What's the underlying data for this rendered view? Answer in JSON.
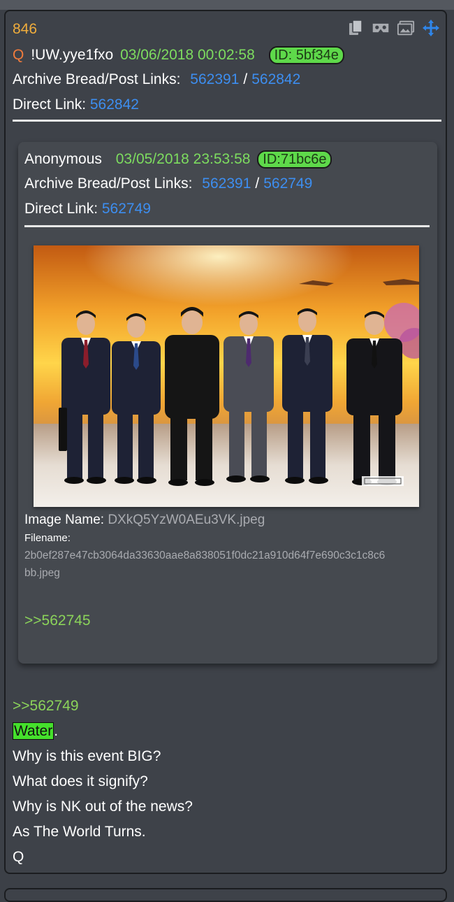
{
  "post": {
    "number": "846",
    "q_marker": "Q",
    "tripcode": "!UW.yye1fxo",
    "date": "03/06/2018 00:02:58",
    "id": "ID: 5bf34e",
    "archive_label": "Archive Bread/Post Links:",
    "archive_link1": "562391",
    "archive_sep": "/",
    "archive_link2": "562842",
    "direct_label": "Direct Link:",
    "direct_link": "562842"
  },
  "quoted": {
    "name": "Anonymous",
    "date": "03/05/2018 23:53:58",
    "id": "ID:71bc6e",
    "archive_label": "Archive Bread/Post Links:",
    "archive_link1": "562391",
    "archive_sep": "/",
    "archive_link2": "562749",
    "direct_label": "Direct Link:",
    "direct_link": "562749",
    "image_name_label": "Image Name:",
    "image_name": "DXkQ5YzW0AEu3VK.jpeg",
    "filename_label": "Filename:",
    "filename_line1": "2b0ef287e47cb3064da33630aae8a838051f0dc21a910d64f7e690c3c1c8c6",
    "filename_line2": "bb.jpeg",
    "reply_link": ">>562745"
  },
  "body": {
    "reply_link": ">>562749",
    "highlight_word": "Water",
    "after_highlight": ".",
    "lines": [
      "Why is this event BIG?",
      "What does it signify?",
      "Why is NK out of the news?",
      "As The World Turns.",
      "Q"
    ]
  },
  "icons": [
    "copy-icon",
    "vr-glasses-icon",
    "image-gallery-icon",
    "move-arrows-icon"
  ],
  "colors": {
    "background": "#3c4047",
    "post_number": "#f0ad3c",
    "q_marker": "#f07b3c",
    "date_green": "#7ddc5f",
    "id_badge": "#5ed94a",
    "link_blue": "#3d8ef0",
    "greentext": "#8bd35a",
    "highlight": "#45e02c"
  }
}
